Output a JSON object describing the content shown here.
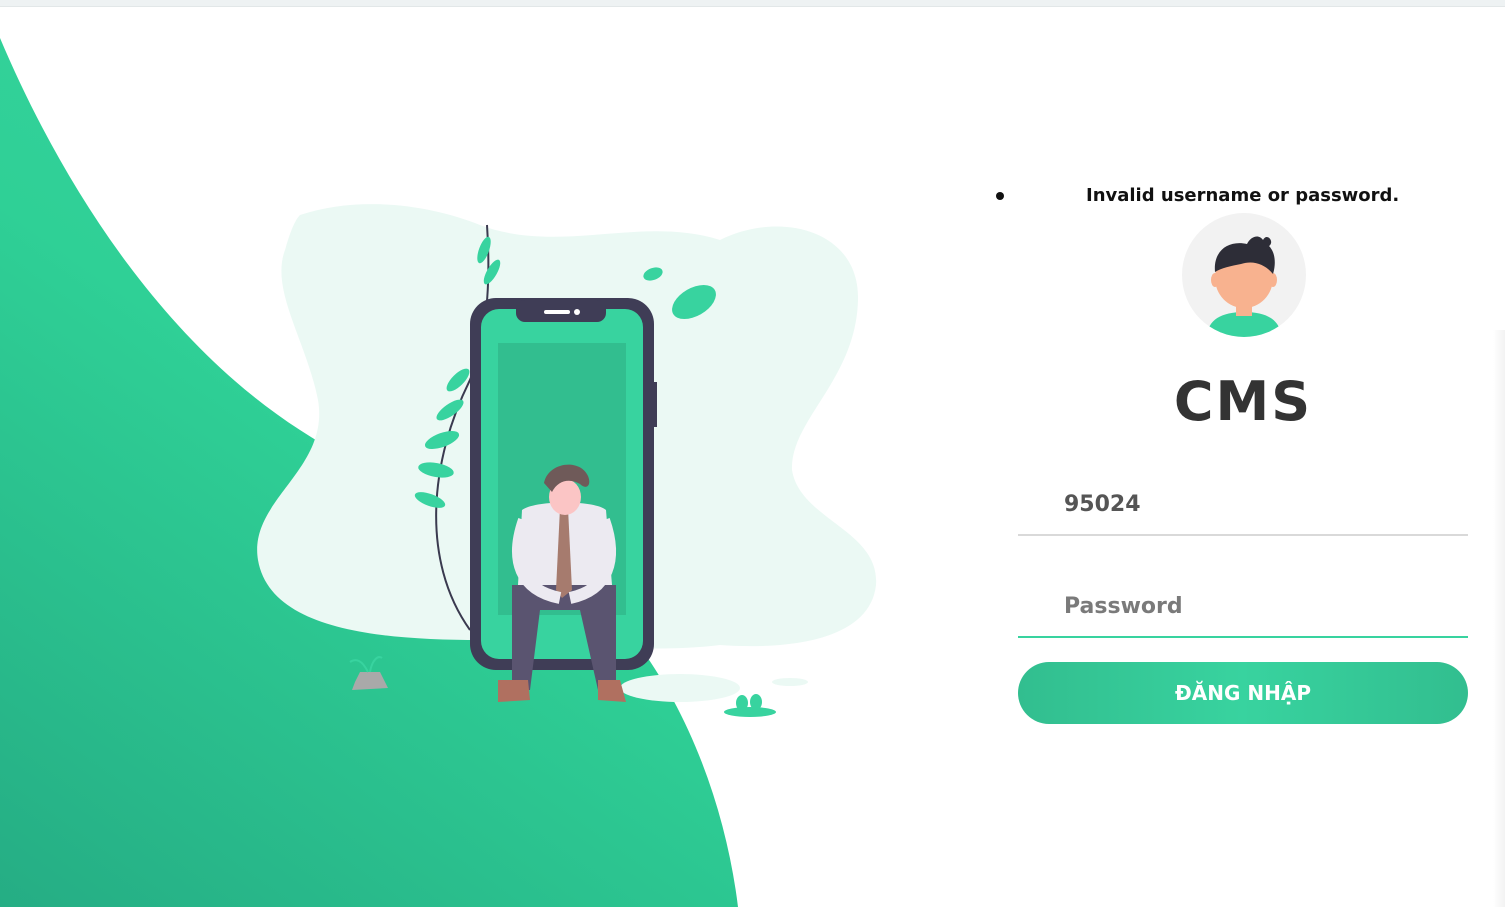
{
  "colors": {
    "accent": "#38d39f",
    "accent_dark": "#32be8f",
    "title": "#333333",
    "background": "#ffffff"
  },
  "illustration": {
    "icon": "person-sitting-on-phone-illustration"
  },
  "login_form": {
    "errors": [
      "Invalid username or password."
    ],
    "avatar_icon": "user-avatar-icon",
    "title": "CMS",
    "username": {
      "value": "95024",
      "placeholder": ""
    },
    "password": {
      "value": "",
      "placeholder": "Password"
    },
    "submit_label": "ĐĂNG NHẬP"
  }
}
